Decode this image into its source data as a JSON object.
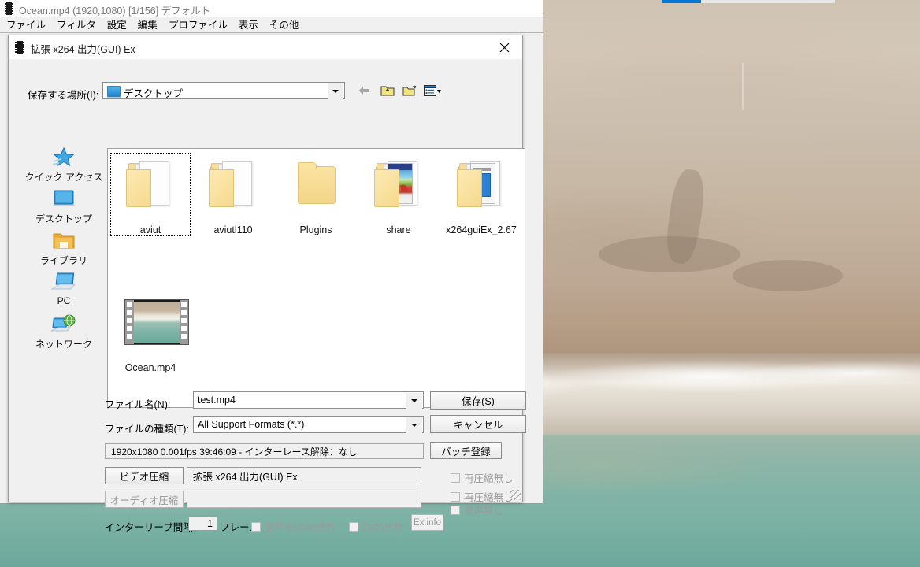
{
  "aviutl": {
    "title": "Ocean.mp4 (1920,1080)  [1/156]  デフォルト",
    "menu": [
      "ファイル",
      "フィルタ",
      "設定",
      "編集",
      "プロファイル",
      "表示",
      "その他"
    ]
  },
  "dialog": {
    "title": "拡張 x264 出力(GUI) Ex",
    "close_icon": "close-icon",
    "lookin": {
      "label": "保存する場所(I):",
      "value": "デスクトップ",
      "icon": "monitor-icon"
    },
    "toolbar": [
      {
        "name": "back-icon",
        "label": "戻る"
      },
      {
        "name": "up-folder-icon",
        "label": "上へ"
      },
      {
        "name": "new-folder-icon",
        "label": "新しいフォルダー"
      },
      {
        "name": "views-icon",
        "label": "表示"
      }
    ],
    "places": [
      {
        "label": "クイック アクセス",
        "icon": "star-icon"
      },
      {
        "label": "デスクトップ",
        "icon": "monitor-icon"
      },
      {
        "label": "ライブラリ",
        "icon": "library-folder-icon"
      },
      {
        "label": "PC",
        "icon": "computer-icon"
      },
      {
        "label": "ネットワーク",
        "icon": "network-icon"
      }
    ],
    "files": [
      {
        "label": "aviut",
        "type": "folder-docs",
        "selected": true
      },
      {
        "label": "aviutl110",
        "type": "folder-docs",
        "selected": false
      },
      {
        "label": "Plugins",
        "type": "folder-plain",
        "selected": false
      },
      {
        "label": "share",
        "type": "folder-preview-color",
        "selected": false
      },
      {
        "label": "x264guiEx_2.67",
        "type": "folder-preview-doc",
        "selected": false
      },
      {
        "label": "Ocean.mp4",
        "type": "video",
        "selected": false
      }
    ],
    "form": {
      "filename_label": "ファイル名(N):",
      "filename_value": "test.mp4",
      "filetype_label": "ファイルの種類(T):",
      "filetype_value": "All Support Formats (*.*)",
      "save_button": "保存(S)",
      "cancel_button": "キャンセル",
      "batch_button": "バッチ登録",
      "info_bar": "1920x1080  0.001fps  39:46:09  -  インターレース解除：なし",
      "video_compress_button": "ビデオ圧縮",
      "video_codec_value": "拡張 x264 出力(GUI) Ex",
      "audio_compress_button": "オーディオ圧縮",
      "audio_codec_value": "",
      "no_recompress_video": "再圧縮無し",
      "no_recompress_audio": "再圧縮無し",
      "no_audio": "音声無し",
      "interleave_label": "インターリーブ間隔：",
      "interleave_value": "1",
      "interleave_unit": "フレーム",
      "wav_output": "音声をWAV出力",
      "log_output": "ログ出力",
      "exinfo_button": "Ex.info"
    }
  },
  "colors": {
    "accent": "#0078d7",
    "dialog_bg": "#f0f0f0",
    "folder_yellow": "#f6dd9b",
    "sea": "#7cb2a4",
    "sand": "#c8b9a7"
  }
}
